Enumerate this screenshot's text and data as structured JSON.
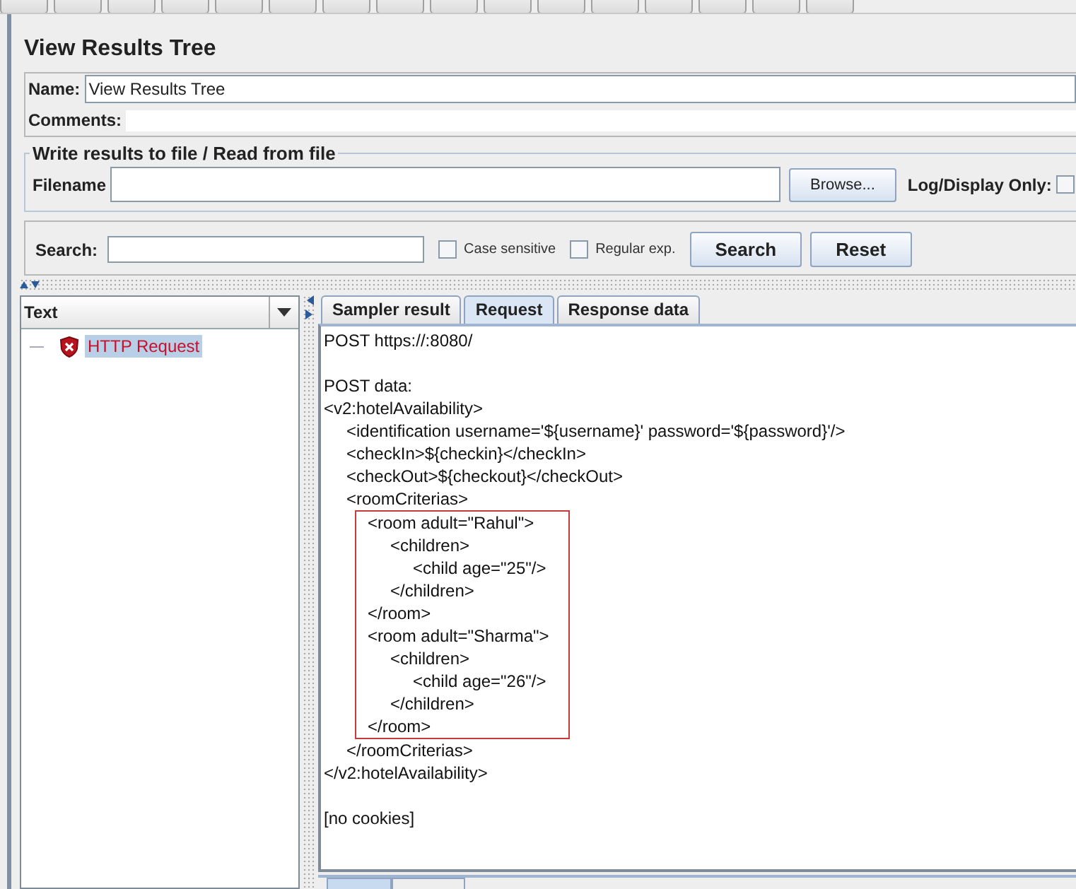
{
  "panel": {
    "title": "View Results Tree",
    "name": {
      "label": "Name:",
      "value": "View Results Tree"
    },
    "comments": {
      "label": "Comments:"
    },
    "file_group": {
      "legend": "Write results to file / Read from file",
      "filename_label": "Filename",
      "browse_button": "Browse...",
      "log_label": "Log/Display Only:",
      "log_checked": false
    },
    "search": {
      "label": "Search:",
      "options": [
        {
          "label": "Case sensitive",
          "checked": false
        },
        {
          "label": "Regular exp.",
          "checked": false
        }
      ],
      "buttons": [
        "Search",
        "Reset"
      ]
    }
  },
  "tree": {
    "column": "Text",
    "items": [
      {
        "label": "HTTP Request",
        "kind": "error",
        "selected": true
      }
    ]
  },
  "tabs": [
    {
      "label": "Sampler result",
      "selected": false
    },
    {
      "label": "Request",
      "selected": true
    },
    {
      "label": "Response data",
      "selected": false
    }
  ],
  "request": [
    [
      {
        "kind": "text",
        "lines": [
          "POST https://:8080/"
        ]
      }
    ],
    [
      {
        "kind": "text",
        "lines": [
          "POST data:",
          "<v2:hotelAvailability>",
          "\t<identification username='${username}' password='${password}'/>",
          "\t<checkIn>${checkin}</checkIn>",
          "\t<checkOut>${checkout}</checkOut>",
          "\t<roomCriterias>"
        ]
      },
      {
        "kind": "highlight",
        "lines": [
          "<room adult=\"Rahul\">",
          "\t<children>",
          "\t\t<child age=\"25\"/>",
          "\t</children>",
          "</room>",
          "<room adult=\"Sharma\">",
          "\t<children>",
          "\t\t<child age=\"26\"/>",
          "\t</children>",
          "</room>"
        ]
      },
      {
        "kind": "text",
        "lines": [
          "\t</roomCriterias>",
          "</v2:hotelAvailability>"
        ]
      }
    ],
    [
      {
        "kind": "text",
        "lines": [
          "[no cookies]"
        ]
      }
    ]
  ],
  "bottom_tabs": [
    {
      "selected": true
    },
    {
      "selected": false
    }
  ]
}
